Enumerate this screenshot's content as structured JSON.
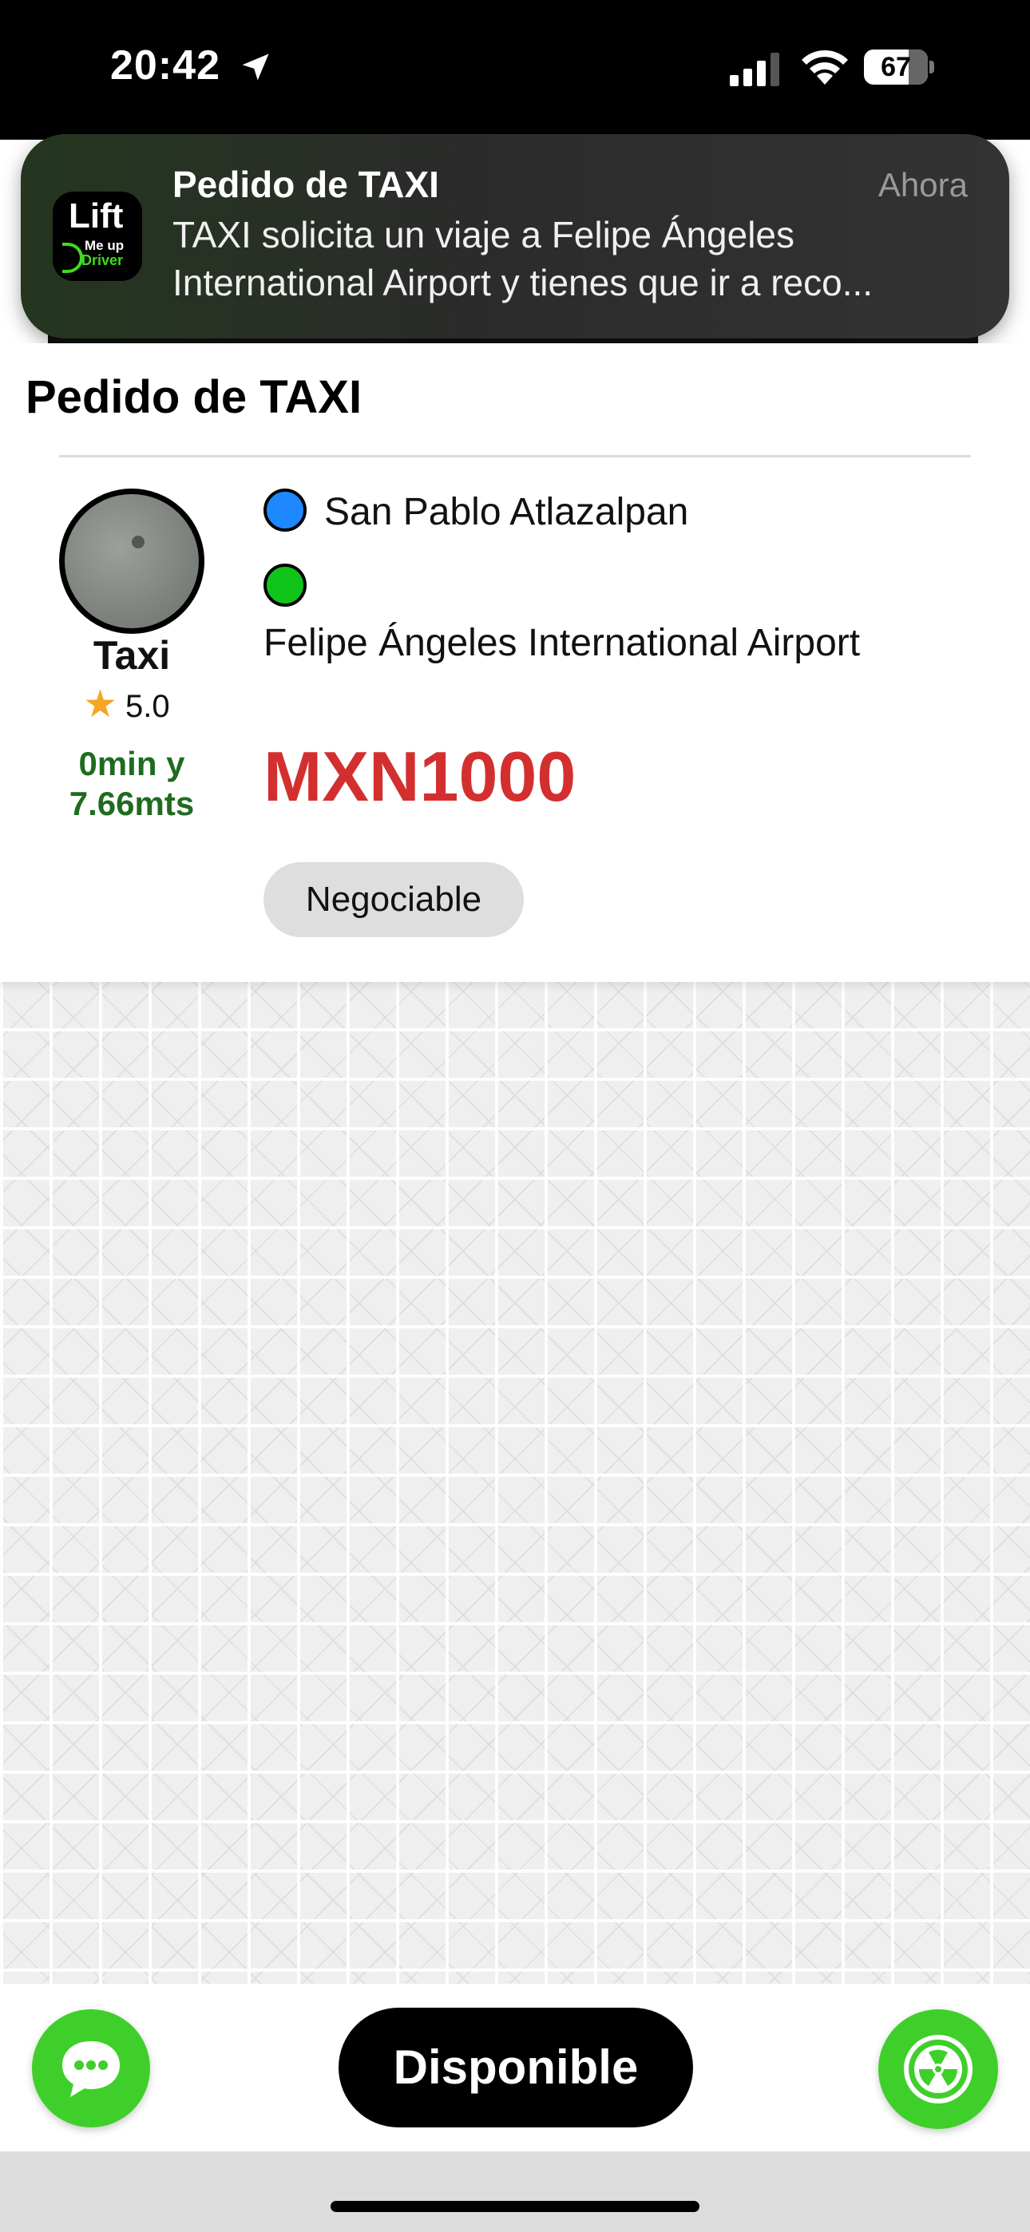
{
  "status_bar": {
    "time": "20:42",
    "battery": "67",
    "icons": [
      "location-arrow-icon",
      "cellular-signal-icon",
      "wifi-icon",
      "battery-icon"
    ]
  },
  "notification": {
    "app_icon": {
      "name": "lift-me-up-driver-app-icon",
      "brand_text": "Lift",
      "brand_sub1": "Me up",
      "brand_sub2": "Driver"
    },
    "title": "Pedido de TAXI",
    "time": "Ahora",
    "body_line1": "TAXI solicita un viaje a Felipe Ángeles",
    "body_line2": "International Airport y tienes que ir a reco..."
  },
  "request_card": {
    "title": "Pedido de TAXI",
    "driver": {
      "name": "Taxi",
      "rating": "5.0",
      "eta_line1": "0min y",
      "eta_line2": "7.66mts"
    },
    "pickup": "San Pablo Atlazalpan",
    "dropoff": "Felipe Ángeles International Airport",
    "price": "MXN1000",
    "negotiable_label": "Negociable"
  },
  "bottom_bar": {
    "chat_icon": "chat-bubble-icon",
    "available_label": "Disponible",
    "radar_icon": "radiation-icon"
  },
  "colors": {
    "accent_green": "#3fcf2a",
    "price_red": "#d32f2f",
    "eta_green": "#1f6b1f",
    "pickup_dot": "#1e88ff",
    "dropoff_dot": "#11c41a"
  }
}
